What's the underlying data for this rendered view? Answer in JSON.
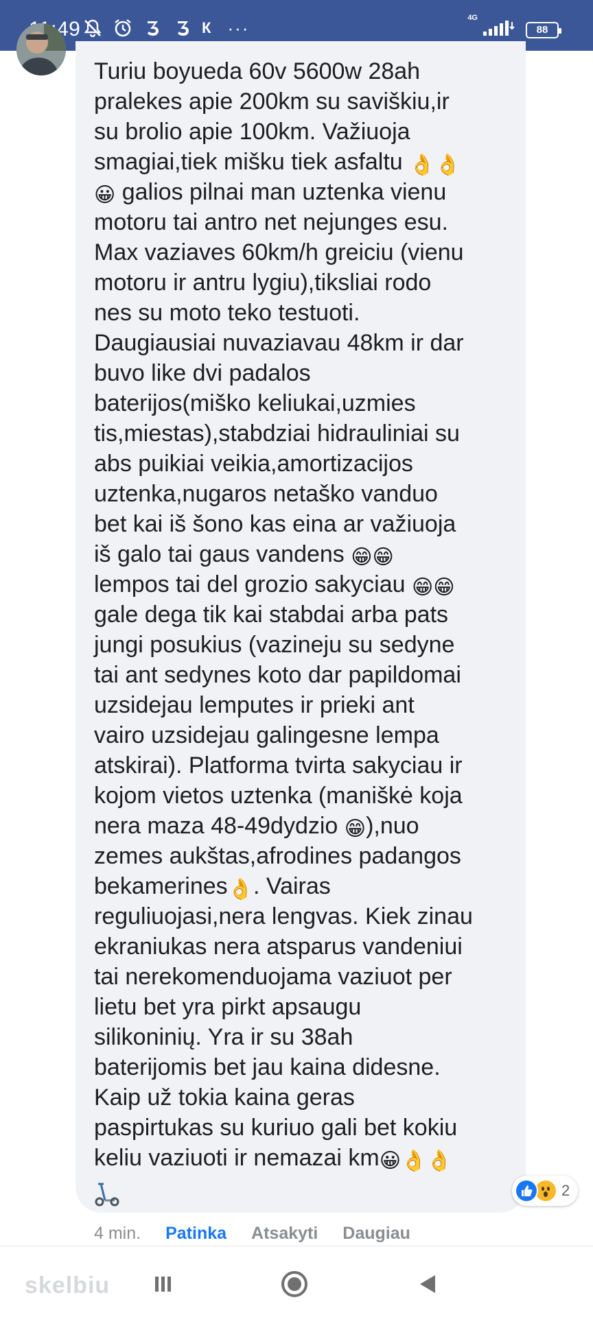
{
  "status_bar": {
    "time": "11:49",
    "carrier_badge": "К",
    "more": "···",
    "network": "4G",
    "battery": "88"
  },
  "comment": {
    "lines": [
      "Turiu boyueda 60v 5600w 28ah",
      "pralekes apie 200km su saviškiu,ir",
      "su brolio apie 100km. Važiuoja",
      "smagiai,tiek mišku tiek asfaltu 👌👌",
      "😀 galios pilnai man uztenka vienu",
      "motoru tai antro net nejunges esu.",
      "Max vaziaves 60km/h greiciu (vienu",
      "motoru ir antru lygiu),tiksliai rodo",
      "nes su moto teko testuoti.",
      "Daugiausiai nuvaziavau 48km ir dar",
      "buvo like dvi padalos",
      "baterijos(miško keliukai,uzmies",
      "tis,miestas),stabdziai hidrauliniai su",
      "abs puikiai veikia,amortizacijos",
      "uztenka,nugaros netaško vanduo",
      "bet kai iš šono kas eina ar važiuoja",
      "iš galo tai gaus vandens 😁😁",
      "lempos tai del grozio sakyciau 😁😁",
      "gale dega tik kai stabdai arba pats",
      "jungi posukius (vazineju su sedyne",
      "tai ant sedynes koto dar papildomai",
      "uzsidejau lemputes ir prieki ant",
      "vairo uzsidejau galingesne lempa",
      "atskirai). Platforma tvirta sakyciau ir",
      "kojom vietos uztenka (maniškė koja",
      "nera maza 48-49dydzio 😁),nuo",
      "zemes aukštas,afrodines padangos",
      "bekamerines👌. Vairas",
      "reguliuojasi,nera lengvas. Kiek zinau",
      "ekraniukas nera atsparus vandeniui",
      "tai nerekomenduojama vaziuot per",
      "lietu bet yra pirkt apsaugu",
      "silikoninių. Yra ir su 38ah",
      "baterijomis bet jau kaina didesne.",
      "Kaip už tokia kaina geras",
      "paspirtukas su kuriuo gali bet kokiu",
      "keliu vaziuoti ir nemazai km😀👌👌"
    ],
    "trailing_icon": "kick-scooter-icon"
  },
  "reactions": {
    "icons": [
      "like-icon",
      "wow-icon"
    ],
    "count": "2"
  },
  "actions": {
    "time": "4 min.",
    "like": "Patinka",
    "reply": "Atsakyti",
    "more": "Daugiau"
  },
  "nav": {
    "watermark": "skelbiu",
    "buttons": [
      "recent-apps",
      "home",
      "back"
    ]
  },
  "colors": {
    "status_bar": "#3b5797",
    "bubble": "#f0f2f5",
    "link": "#1877f2",
    "muted": "#8a8d91"
  }
}
